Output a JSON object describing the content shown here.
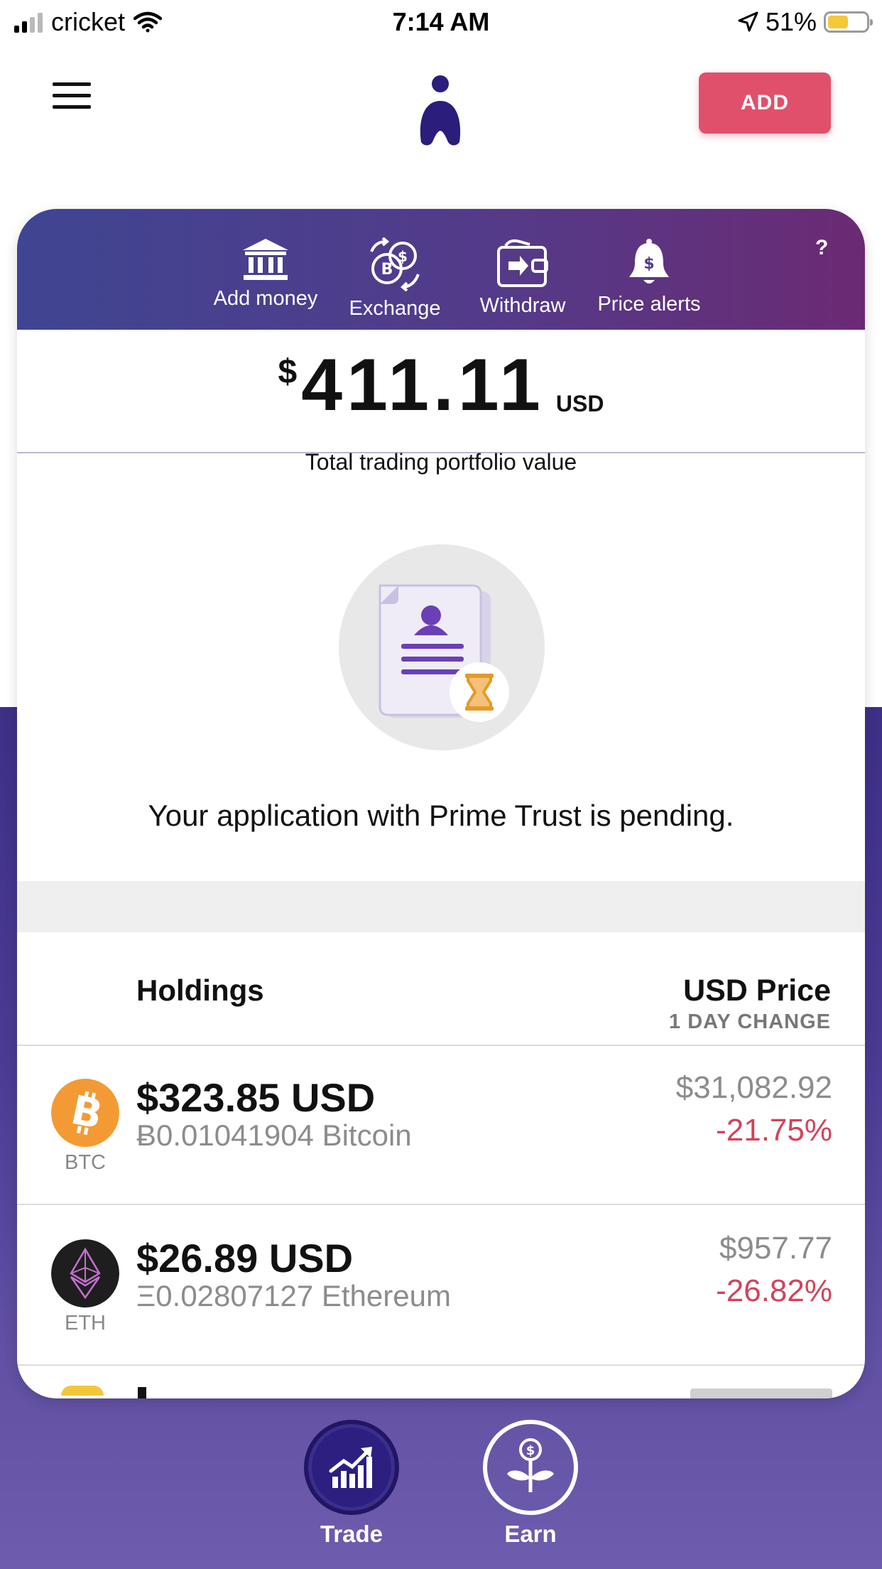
{
  "status_bar": {
    "carrier": "cricket",
    "time": "7:14 AM",
    "battery_pct": "51%",
    "battery_level": 0.51,
    "icons": [
      "signal-icon",
      "wifi-icon",
      "location-icon",
      "battery-icon"
    ]
  },
  "header": {
    "add_label": "ADD",
    "icons": [
      "hamburger-menu-icon",
      "app-logo"
    ]
  },
  "actions": [
    {
      "label": "Add money",
      "icon": "bank-icon"
    },
    {
      "label": "Exchange",
      "icon": "exchange-coins-icon"
    },
    {
      "label": "Withdraw",
      "icon": "wallet-withdraw-icon"
    },
    {
      "label": "Price alerts",
      "icon": "bell-dollar-icon"
    }
  ],
  "help_label": "?",
  "portfolio": {
    "currency_symbol": "$",
    "amount": "411.11",
    "unit": "USD",
    "caption": "Total trading portfolio value"
  },
  "pending": {
    "message": "Your application with Prime Trust is pending.",
    "icon": "document-pending-icon"
  },
  "holdings": {
    "title": "Holdings",
    "price_title": "USD Price",
    "price_subtitle": "1 DAY CHANGE",
    "rows": [
      {
        "symbol": "BTC",
        "usd_value": "$323.85 USD",
        "amount": "Ƀ0.01041904 Bitcoin",
        "price": "$31,082.92",
        "change": "-21.75%",
        "coin_color": "#f39a34",
        "icon": "bitcoin-icon"
      },
      {
        "symbol": "ETH",
        "usd_value": "$26.89 USD",
        "amount": "Ξ0.02807127 Ethereum",
        "price": "$957.77",
        "change": "-26.82%",
        "coin_color": "#1e1e1e",
        "icon": "ethereum-icon"
      }
    ]
  },
  "bottom_nav": {
    "trade_label": "Trade",
    "earn_label": "Earn"
  },
  "colors": {
    "accent_red": "#e0506a",
    "brand_purple": "#2c1f80",
    "negative": "#d1435c"
  }
}
